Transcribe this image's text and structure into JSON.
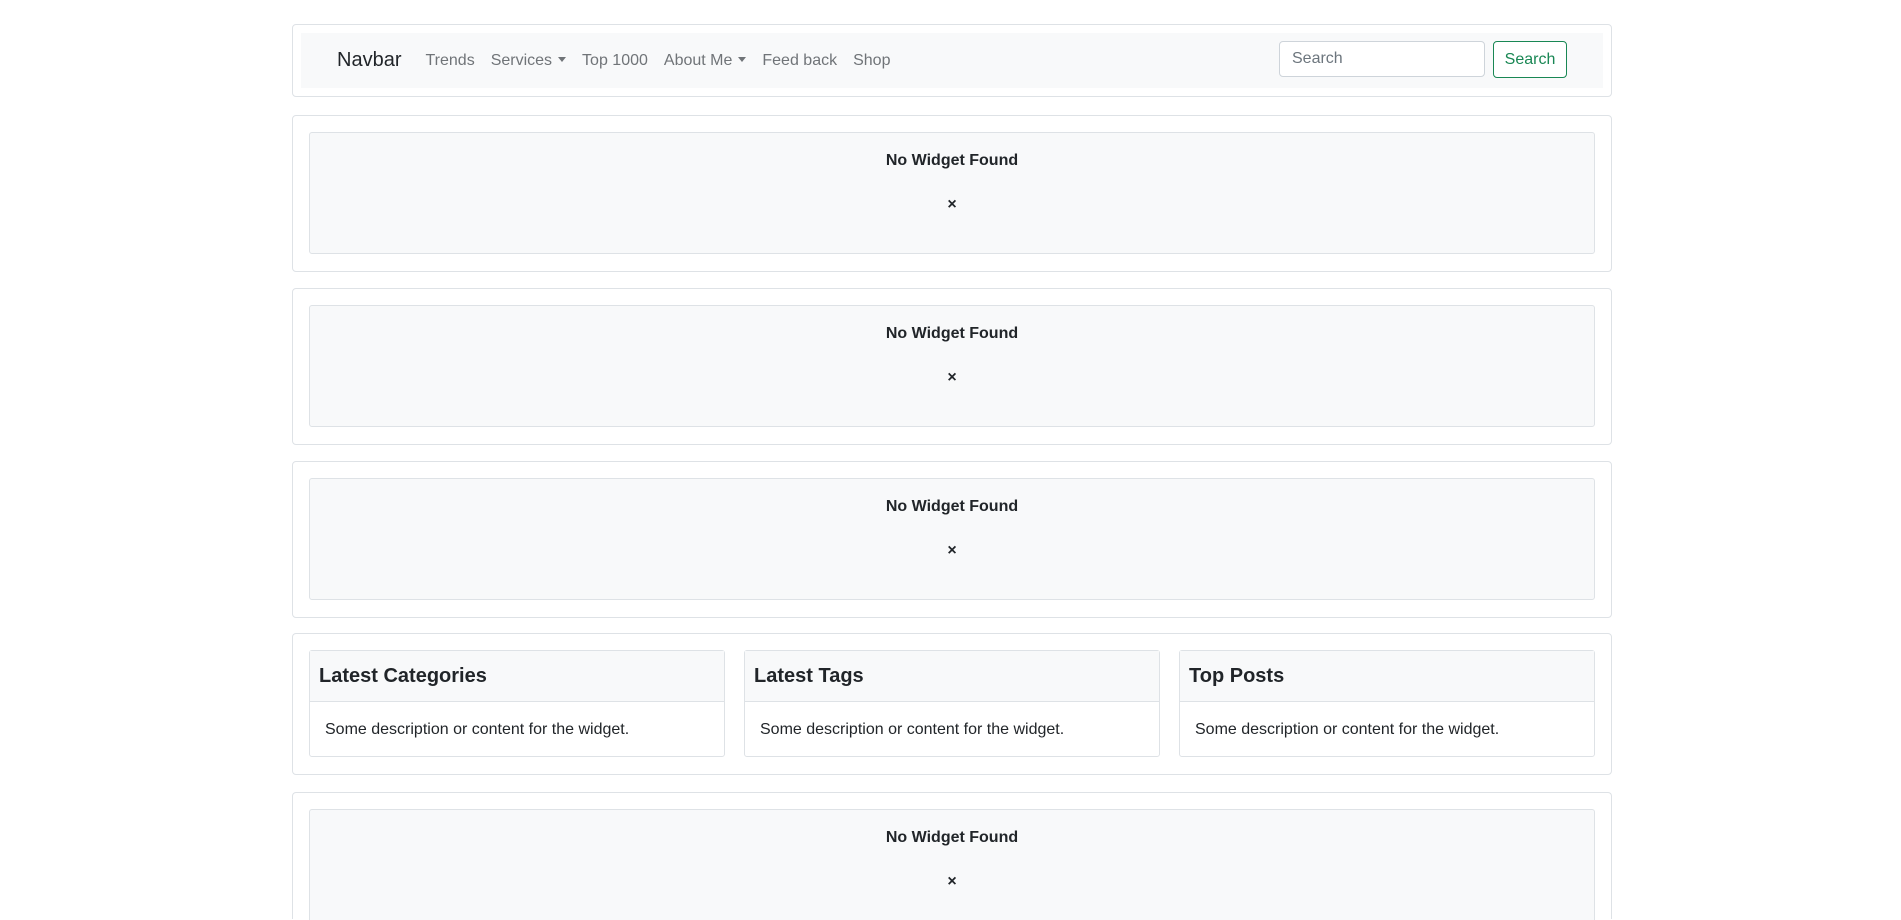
{
  "navbar": {
    "brand": "Navbar",
    "links": [
      {
        "label": "Trends",
        "dropdown": false
      },
      {
        "label": "Services",
        "dropdown": true
      },
      {
        "label": "Top 1000",
        "dropdown": false
      },
      {
        "label": "About Me",
        "dropdown": true
      },
      {
        "label": "Feed back",
        "dropdown": false
      },
      {
        "label": "Shop",
        "dropdown": false
      }
    ],
    "search_placeholder": "Search",
    "search_button": "Search"
  },
  "empty_widgets": [
    {
      "title": "No Widget Found",
      "close": "×"
    },
    {
      "title": "No Widget Found",
      "close": "×"
    },
    {
      "title": "No Widget Found",
      "close": "×"
    },
    {
      "title": "No Widget Found",
      "close": "×"
    }
  ],
  "cards": [
    {
      "title": "Latest Categories",
      "body": "Some description or content for the widget."
    },
    {
      "title": "Latest Tags",
      "body": "Some description or content for the widget."
    },
    {
      "title": "Top Posts",
      "body": "Some description or content for the widget."
    }
  ],
  "colors": {
    "accent": "#198754",
    "panel": "#f8f9fa",
    "border": "#dee2e6"
  }
}
